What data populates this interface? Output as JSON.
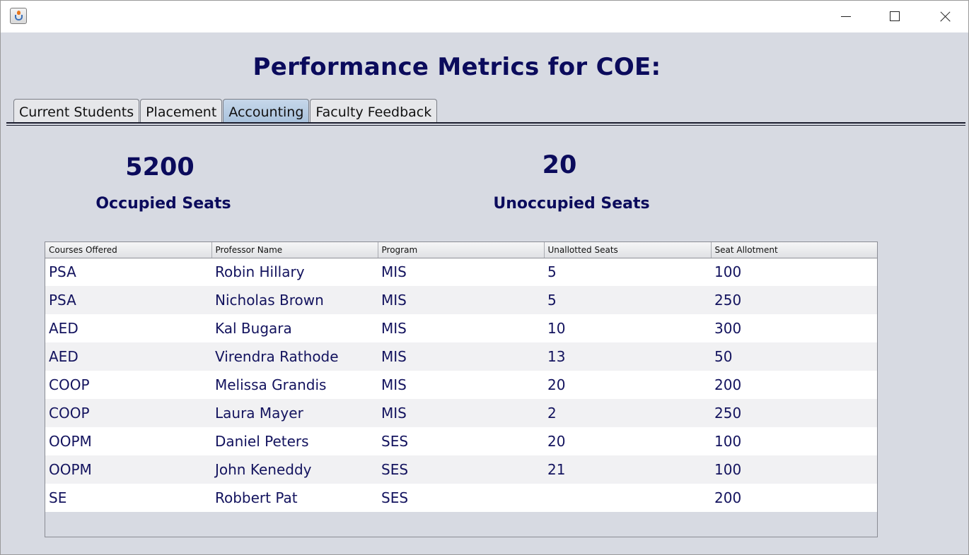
{
  "window": {
    "title": "",
    "app_icon": "java-cup-icon",
    "controls": [
      "minimize-icon",
      "maximize-icon",
      "close-icon"
    ]
  },
  "header": {
    "title": "Performance Metrics for COE:"
  },
  "tabs": [
    {
      "label": "Current Students",
      "active": false
    },
    {
      "label": "Placement",
      "active": false
    },
    {
      "label": "Accounting",
      "active": true
    },
    {
      "label": "Faculty Feedback",
      "active": false
    }
  ],
  "metrics": {
    "occupied": {
      "value": "5200",
      "label": "Occupied Seats"
    },
    "unoccupied": {
      "value": "20",
      "label": "Unoccupied Seats"
    }
  },
  "table": {
    "columns": [
      "Courses Offered",
      "Professor Name",
      "Program",
      "Unallotted Seats",
      "Seat Allotment"
    ],
    "rows": [
      [
        "PSA",
        "Robin Hillary",
        "MIS",
        "5",
        "100"
      ],
      [
        "PSA",
        "Nicholas Brown",
        "MIS",
        "5",
        "250"
      ],
      [
        "AED",
        "Kal Bugara",
        "MIS",
        "10",
        "300"
      ],
      [
        "AED",
        "Virendra Rathode",
        "MIS",
        "13",
        "50"
      ],
      [
        "COOP",
        "Melissa Grandis",
        "MIS",
        "20",
        "200"
      ],
      [
        "COOP",
        "Laura Mayer",
        "MIS",
        "2",
        "250"
      ],
      [
        "OOPM",
        "Daniel Peters",
        "SES",
        "20",
        "100"
      ],
      [
        "OOPM",
        "John Keneddy",
        "SES",
        "21",
        "100"
      ],
      [
        "SE",
        "Robbert Pat",
        "SES",
        "",
        "200"
      ]
    ]
  },
  "colors": {
    "background": "#d7dae2",
    "title_text": "#0b0b5c",
    "active_tab": "#b4c9e0"
  }
}
